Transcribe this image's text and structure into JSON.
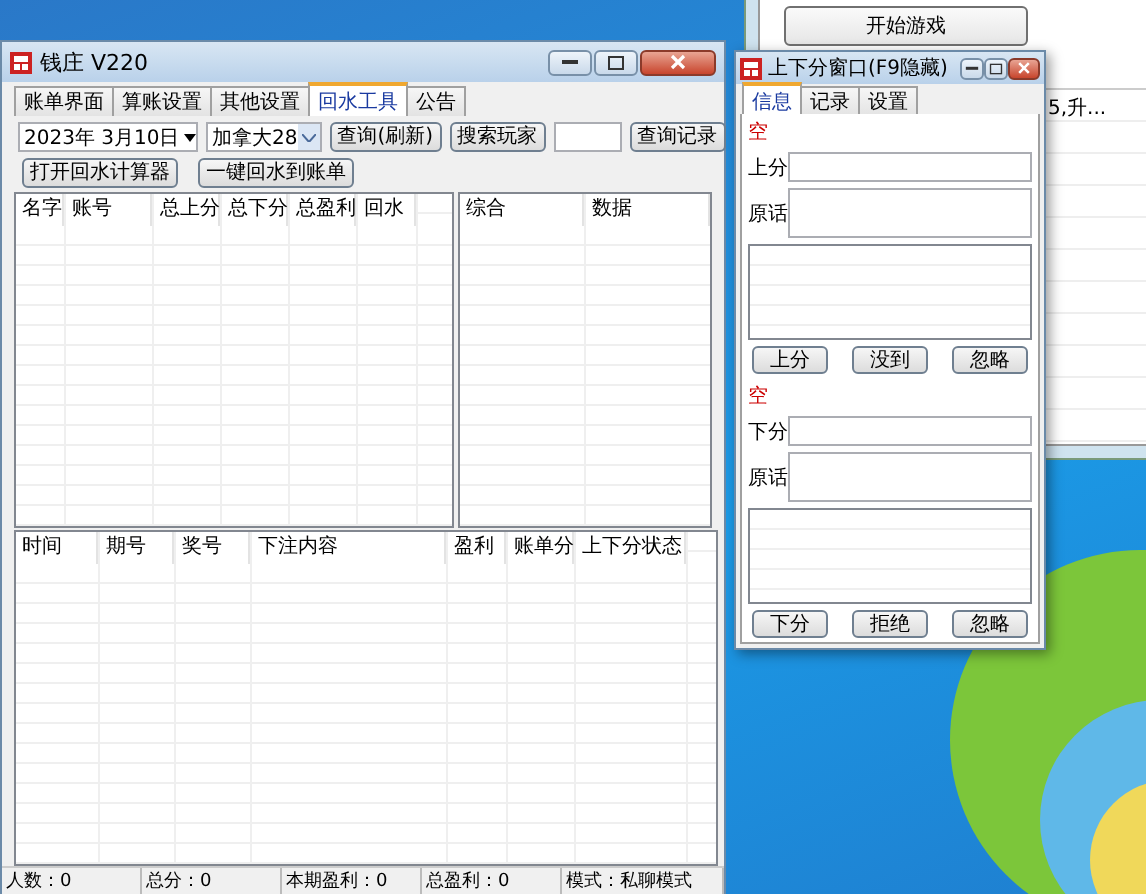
{
  "back_window": {
    "button": "开始游戏",
    "cell_text": "5,升..."
  },
  "main_window": {
    "title": "钱庄 V220",
    "tabs": [
      {
        "label": "账单界面",
        "selected": false
      },
      {
        "label": "算账设置",
        "selected": false
      },
      {
        "label": "其他设置",
        "selected": false
      },
      {
        "label": "回水工具",
        "selected": true
      },
      {
        "label": "公告",
        "selected": false
      }
    ],
    "date_picker": {
      "value": "2023年  3月10日"
    },
    "game_select": {
      "value": "加拿大28"
    },
    "refresh_button": "查询(刷新)",
    "search_player_button": "搜索玩家",
    "query_records_button": "查询记录",
    "rebate_calculator_button": "打开回水计算器",
    "rebate_to_bill_button": "一键回水到账单",
    "player_table": {
      "columns": [
        "名字",
        "账号",
        "总上分",
        "总下分",
        "总盈利",
        "回水"
      ]
    },
    "summary_table": {
      "columns": [
        "综合",
        "数据"
      ]
    },
    "log_table": {
      "columns": [
        "时间",
        "期号",
        "奖号",
        "下注内容",
        "盈利",
        "账单分",
        "上下分状态"
      ]
    },
    "status_bar": [
      "人数：0",
      "总分：0",
      "本期盈利：0",
      "总盈利：0",
      "模式：私聊模式"
    ]
  },
  "side_window": {
    "title": "上下分窗口(F9隐藏)",
    "tabs": [
      {
        "label": "信息",
        "selected": true
      },
      {
        "label": "记录",
        "selected": false
      },
      {
        "label": "设置",
        "selected": false
      }
    ],
    "sections": [
      {
        "status": "空",
        "amount_label": "上分",
        "message_label": "原话",
        "buttons": [
          "上分",
          "没到",
          "忽略"
        ]
      },
      {
        "status": "空",
        "amount_label": "下分",
        "message_label": "原话",
        "buttons": [
          "下分",
          "拒绝",
          "忽略"
        ]
      }
    ]
  }
}
